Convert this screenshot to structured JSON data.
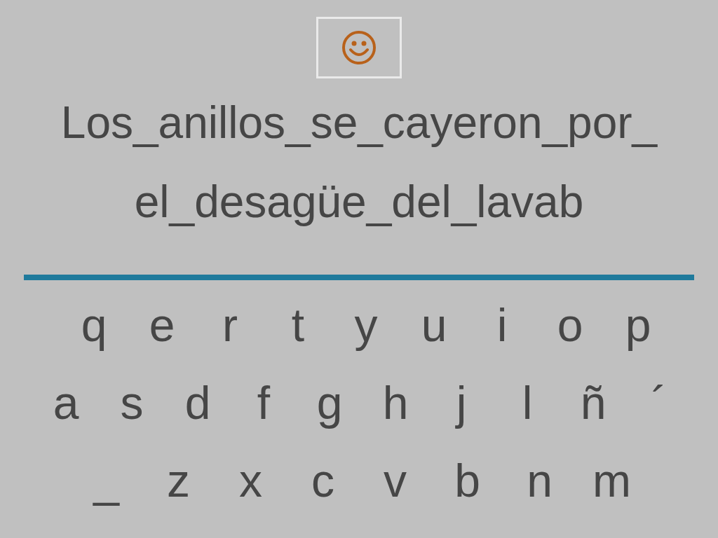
{
  "sentence_lines": [
    "Los_anillos_se_cayeron_por_",
    "el_desagüe_del_lavab"
  ],
  "keyboard_rows": [
    [
      "q",
      "e",
      "r",
      "t",
      "y",
      "u",
      "i",
      "o",
      "p"
    ],
    [
      "a",
      "s",
      "d",
      "f",
      "g",
      "h",
      "j",
      "l",
      "ñ",
      "´"
    ],
    [
      "_",
      "z",
      "x",
      "c",
      "v",
      "b",
      "n",
      "m"
    ]
  ]
}
